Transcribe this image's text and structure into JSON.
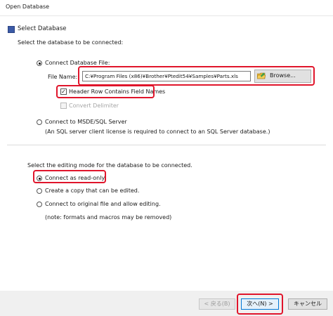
{
  "window": {
    "title": "Open Database"
  },
  "section": {
    "header": "Select Database"
  },
  "db_prompt": "Select the database to be connected:",
  "db_options": {
    "file": "Connect Database File:",
    "file_name_label": "File Name:",
    "file_path": "C:¥Program Files (x86)¥Brother¥Ptedit54¥Samples¥Parts.xls",
    "browse_label": "Browse...",
    "header_row": "Header Row Contains Field Names",
    "convert": "Convert Delimiter",
    "sql": "Connect to MSDE/SQL Server",
    "sql_note": "(An SQL server client license is required to connect to an SQL Server database.)"
  },
  "edit_prompt": "Select the editing mode for the database to be connected.",
  "edit_options": {
    "readonly": "Connect as read-only.",
    "copy": "Create a copy that can be edited.",
    "original": "Connect to original file and allow editing.",
    "note": "(note:  formats and macros may be removed)"
  },
  "buttons": {
    "back": "< 戻る(B)",
    "next": "次へ(N) >",
    "cancel": "キャンセル"
  },
  "colors": {
    "highlight": "#e0152b",
    "accent": "#0078d7"
  }
}
